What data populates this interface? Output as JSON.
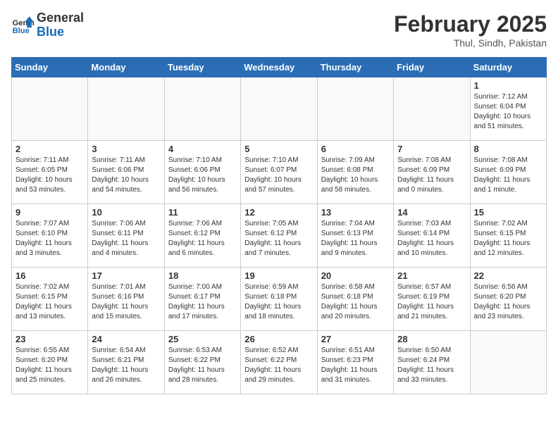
{
  "header": {
    "logo_line1": "General",
    "logo_line2": "Blue",
    "month": "February 2025",
    "location": "Thul, Sindh, Pakistan"
  },
  "days_of_week": [
    "Sunday",
    "Monday",
    "Tuesday",
    "Wednesday",
    "Thursday",
    "Friday",
    "Saturday"
  ],
  "weeks": [
    [
      {
        "day": "",
        "info": ""
      },
      {
        "day": "",
        "info": ""
      },
      {
        "day": "",
        "info": ""
      },
      {
        "day": "",
        "info": ""
      },
      {
        "day": "",
        "info": ""
      },
      {
        "day": "",
        "info": ""
      },
      {
        "day": "1",
        "info": "Sunrise: 7:12 AM\nSunset: 6:04 PM\nDaylight: 10 hours and 51 minutes."
      }
    ],
    [
      {
        "day": "2",
        "info": "Sunrise: 7:11 AM\nSunset: 6:05 PM\nDaylight: 10 hours and 53 minutes."
      },
      {
        "day": "3",
        "info": "Sunrise: 7:11 AM\nSunset: 6:06 PM\nDaylight: 10 hours and 54 minutes."
      },
      {
        "day": "4",
        "info": "Sunrise: 7:10 AM\nSunset: 6:06 PM\nDaylight: 10 hours and 56 minutes."
      },
      {
        "day": "5",
        "info": "Sunrise: 7:10 AM\nSunset: 6:07 PM\nDaylight: 10 hours and 57 minutes."
      },
      {
        "day": "6",
        "info": "Sunrise: 7:09 AM\nSunset: 6:08 PM\nDaylight: 10 hours and 58 minutes."
      },
      {
        "day": "7",
        "info": "Sunrise: 7:08 AM\nSunset: 6:09 PM\nDaylight: 11 hours and 0 minutes."
      },
      {
        "day": "8",
        "info": "Sunrise: 7:08 AM\nSunset: 6:09 PM\nDaylight: 11 hours and 1 minute."
      }
    ],
    [
      {
        "day": "9",
        "info": "Sunrise: 7:07 AM\nSunset: 6:10 PM\nDaylight: 11 hours and 3 minutes."
      },
      {
        "day": "10",
        "info": "Sunrise: 7:06 AM\nSunset: 6:11 PM\nDaylight: 11 hours and 4 minutes."
      },
      {
        "day": "11",
        "info": "Sunrise: 7:06 AM\nSunset: 6:12 PM\nDaylight: 11 hours and 6 minutes."
      },
      {
        "day": "12",
        "info": "Sunrise: 7:05 AM\nSunset: 6:12 PM\nDaylight: 11 hours and 7 minutes."
      },
      {
        "day": "13",
        "info": "Sunrise: 7:04 AM\nSunset: 6:13 PM\nDaylight: 11 hours and 9 minutes."
      },
      {
        "day": "14",
        "info": "Sunrise: 7:03 AM\nSunset: 6:14 PM\nDaylight: 11 hours and 10 minutes."
      },
      {
        "day": "15",
        "info": "Sunrise: 7:02 AM\nSunset: 6:15 PM\nDaylight: 11 hours and 12 minutes."
      }
    ],
    [
      {
        "day": "16",
        "info": "Sunrise: 7:02 AM\nSunset: 6:15 PM\nDaylight: 11 hours and 13 minutes."
      },
      {
        "day": "17",
        "info": "Sunrise: 7:01 AM\nSunset: 6:16 PM\nDaylight: 11 hours and 15 minutes."
      },
      {
        "day": "18",
        "info": "Sunrise: 7:00 AM\nSunset: 6:17 PM\nDaylight: 11 hours and 17 minutes."
      },
      {
        "day": "19",
        "info": "Sunrise: 6:59 AM\nSunset: 6:18 PM\nDaylight: 11 hours and 18 minutes."
      },
      {
        "day": "20",
        "info": "Sunrise: 6:58 AM\nSunset: 6:18 PM\nDaylight: 11 hours and 20 minutes."
      },
      {
        "day": "21",
        "info": "Sunrise: 6:57 AM\nSunset: 6:19 PM\nDaylight: 11 hours and 21 minutes."
      },
      {
        "day": "22",
        "info": "Sunrise: 6:56 AM\nSunset: 6:20 PM\nDaylight: 11 hours and 23 minutes."
      }
    ],
    [
      {
        "day": "23",
        "info": "Sunrise: 6:55 AM\nSunset: 6:20 PM\nDaylight: 11 hours and 25 minutes."
      },
      {
        "day": "24",
        "info": "Sunrise: 6:54 AM\nSunset: 6:21 PM\nDaylight: 11 hours and 26 minutes."
      },
      {
        "day": "25",
        "info": "Sunrise: 6:53 AM\nSunset: 6:22 PM\nDaylight: 11 hours and 28 minutes."
      },
      {
        "day": "26",
        "info": "Sunrise: 6:52 AM\nSunset: 6:22 PM\nDaylight: 11 hours and 29 minutes."
      },
      {
        "day": "27",
        "info": "Sunrise: 6:51 AM\nSunset: 6:23 PM\nDaylight: 11 hours and 31 minutes."
      },
      {
        "day": "28",
        "info": "Sunrise: 6:50 AM\nSunset: 6:24 PM\nDaylight: 11 hours and 33 minutes."
      },
      {
        "day": "",
        "info": ""
      }
    ]
  ]
}
